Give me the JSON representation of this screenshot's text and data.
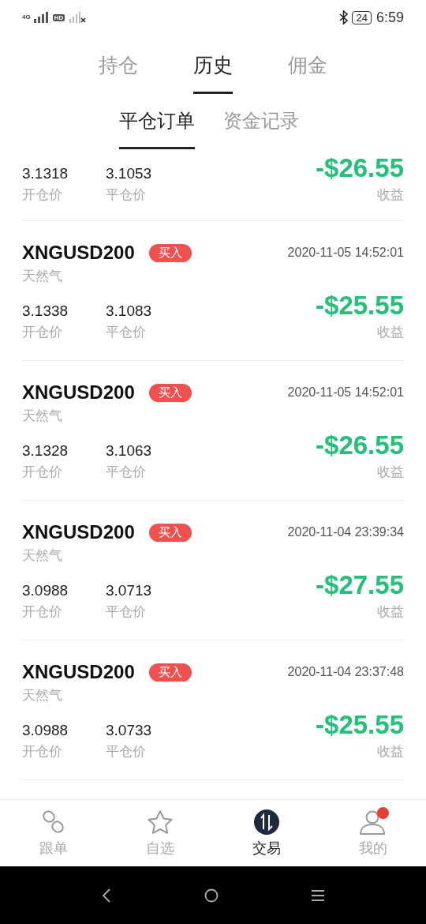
{
  "status_bar": {
    "network": "4G",
    "hd": "HD",
    "battery": "24",
    "time": "6:59"
  },
  "tabs": [
    {
      "label": "持仓",
      "selected": false
    },
    {
      "label": "历史",
      "selected": true
    },
    {
      "label": "佣金",
      "selected": false
    }
  ],
  "subtabs": [
    {
      "label": "平仓订单",
      "selected": true
    },
    {
      "label": "资金记录",
      "selected": false
    }
  ],
  "orders": [
    {
      "open_price": "3.1318",
      "open_label": "开仓价",
      "close_price": "3.1053",
      "close_label": "平仓价",
      "profit": "-$26.55",
      "profit_label": "收益"
    },
    {
      "symbol": "XNGUSD200",
      "side": "买入",
      "time": "2020-11-05 14:52:01",
      "name": "天然气",
      "open_price": "3.1338",
      "open_label": "开仓价",
      "close_price": "3.1083",
      "close_label": "平仓价",
      "profit": "-$25.55",
      "profit_label": "收益"
    },
    {
      "symbol": "XNGUSD200",
      "side": "买入",
      "time": "2020-11-05 14:52:01",
      "name": "天然气",
      "open_price": "3.1328",
      "open_label": "开仓价",
      "close_price": "3.1063",
      "close_label": "平仓价",
      "profit": "-$26.55",
      "profit_label": "收益"
    },
    {
      "symbol": "XNGUSD200",
      "side": "买入",
      "time": "2020-11-04 23:39:34",
      "name": "天然气",
      "open_price": "3.0988",
      "open_label": "开仓价",
      "close_price": "3.0713",
      "close_label": "平仓价",
      "profit": "-$27.55",
      "profit_label": "收益"
    },
    {
      "symbol": "XNGUSD200",
      "side": "买入",
      "time": "2020-11-04 23:37:48",
      "name": "天然气",
      "open_price": "3.0988",
      "open_label": "开仓价",
      "close_price": "3.0733",
      "close_label": "平仓价",
      "profit": "-$25.55",
      "profit_label": "收益"
    }
  ],
  "bottom_nav": [
    {
      "kind": "link",
      "label": "跟单",
      "selected": false,
      "badge": false
    },
    {
      "kind": "star",
      "label": "自选",
      "selected": false,
      "badge": false
    },
    {
      "kind": "trade",
      "label": "交易",
      "selected": true,
      "badge": false
    },
    {
      "kind": "user",
      "label": "我的",
      "selected": false,
      "badge": true
    }
  ]
}
